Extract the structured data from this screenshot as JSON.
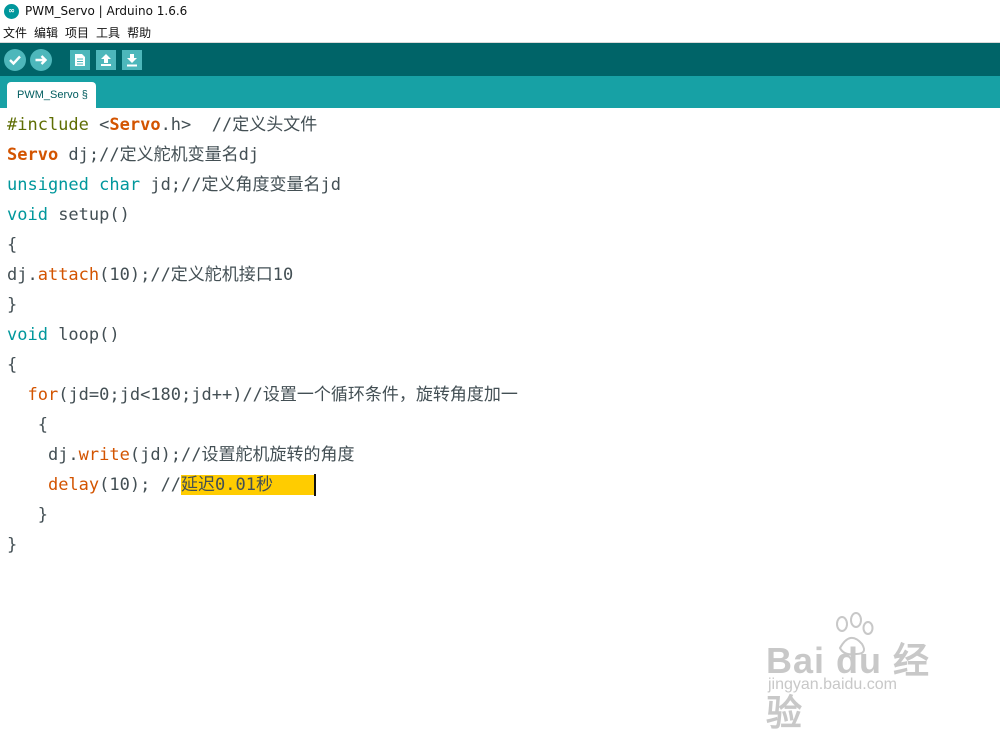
{
  "window": {
    "title": "PWM_Servo | Arduino 1.6.6",
    "app_icon": "arduino-infinity-icon"
  },
  "menu": {
    "items": [
      "文件",
      "编辑",
      "项目",
      "工具",
      "帮助"
    ]
  },
  "toolbar": {
    "buttons": [
      "verify-icon",
      "upload-icon",
      "new-icon",
      "open-icon",
      "save-icon"
    ],
    "colors": {
      "bar": "#006468",
      "button": "#4db7bb"
    }
  },
  "tabs": [
    {
      "label": "PWM_Servo §"
    }
  ],
  "code": {
    "l1": {
      "pre": "#include ",
      "lt": "<",
      "cls": "Servo",
      "hdr": ".h",
      "gt": "> ",
      "comment": " //定义头文件"
    },
    "l2": {
      "cls": "Servo",
      "rest": " dj;",
      "comment": "//定义舵机变量名dj"
    },
    "l3": {
      "t1": "unsigned",
      "sp": " ",
      "t2": "char",
      "rest": " jd;",
      "comment": "//定义角度变量名jd"
    },
    "l4": {
      "t1": "void",
      "rest": " setup()"
    },
    "l5": {
      "text": "{"
    },
    "l6": {
      "obj": "dj.",
      "fn": "attach",
      "rest": "(10);",
      "comment": "//定义舵机接口10"
    },
    "l7": {
      "text": "}"
    },
    "l8": {
      "t1": "void",
      "rest": " loop()"
    },
    "l9": {
      "text": "{"
    },
    "l10": {
      "indent": "  ",
      "kw": "for",
      "rest": "(jd=0;jd<180;jd++)",
      "comment": "//设置一个循环条件，旋转角度加一"
    },
    "l11": {
      "text": "   {"
    },
    "l12": {
      "indent": "    ",
      "obj": "dj.",
      "fn": "write",
      "rest": "(jd);",
      "comment": "//设置舵机旋转的角度"
    },
    "l13": {
      "indent": "    ",
      "fn": "delay",
      "rest": "(10); ",
      "comment": "//",
      "highlight": "延迟0.01秒    "
    },
    "l14": {
      "text": "   }"
    },
    "l15": {
      "text": "}"
    }
  },
  "watermark": {
    "brand": "Bai du 经验",
    "site": "jingyan.baidu.com"
  },
  "colors": {
    "keyword_type": "#00979c",
    "keyword_class": "#d35400",
    "highlight": "#ffcc00",
    "tab_bar": "#17a1a5"
  }
}
